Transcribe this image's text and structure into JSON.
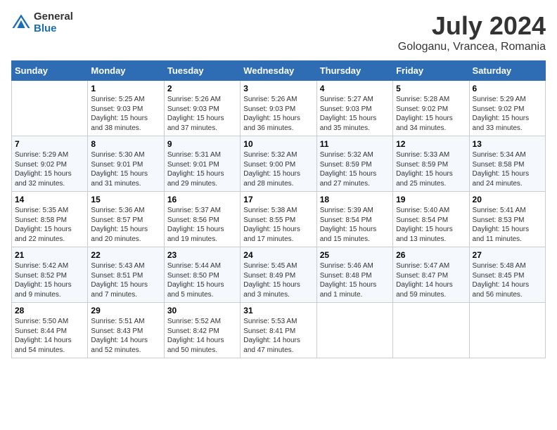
{
  "header": {
    "logo_line1": "General",
    "logo_line2": "Blue",
    "title": "July 2024",
    "subtitle": "Gologanu, Vrancea, Romania"
  },
  "weekdays": [
    "Sunday",
    "Monday",
    "Tuesday",
    "Wednesday",
    "Thursday",
    "Friday",
    "Saturday"
  ],
  "weeks": [
    [
      {
        "day": "",
        "info": ""
      },
      {
        "day": "1",
        "info": "Sunrise: 5:25 AM\nSunset: 9:03 PM\nDaylight: 15 hours\nand 38 minutes."
      },
      {
        "day": "2",
        "info": "Sunrise: 5:26 AM\nSunset: 9:03 PM\nDaylight: 15 hours\nand 37 minutes."
      },
      {
        "day": "3",
        "info": "Sunrise: 5:26 AM\nSunset: 9:03 PM\nDaylight: 15 hours\nand 36 minutes."
      },
      {
        "day": "4",
        "info": "Sunrise: 5:27 AM\nSunset: 9:03 PM\nDaylight: 15 hours\nand 35 minutes."
      },
      {
        "day": "5",
        "info": "Sunrise: 5:28 AM\nSunset: 9:02 PM\nDaylight: 15 hours\nand 34 minutes."
      },
      {
        "day": "6",
        "info": "Sunrise: 5:29 AM\nSunset: 9:02 PM\nDaylight: 15 hours\nand 33 minutes."
      }
    ],
    [
      {
        "day": "7",
        "info": "Sunrise: 5:29 AM\nSunset: 9:02 PM\nDaylight: 15 hours\nand 32 minutes."
      },
      {
        "day": "8",
        "info": "Sunrise: 5:30 AM\nSunset: 9:01 PM\nDaylight: 15 hours\nand 31 minutes."
      },
      {
        "day": "9",
        "info": "Sunrise: 5:31 AM\nSunset: 9:01 PM\nDaylight: 15 hours\nand 29 minutes."
      },
      {
        "day": "10",
        "info": "Sunrise: 5:32 AM\nSunset: 9:00 PM\nDaylight: 15 hours\nand 28 minutes."
      },
      {
        "day": "11",
        "info": "Sunrise: 5:32 AM\nSunset: 8:59 PM\nDaylight: 15 hours\nand 27 minutes."
      },
      {
        "day": "12",
        "info": "Sunrise: 5:33 AM\nSunset: 8:59 PM\nDaylight: 15 hours\nand 25 minutes."
      },
      {
        "day": "13",
        "info": "Sunrise: 5:34 AM\nSunset: 8:58 PM\nDaylight: 15 hours\nand 24 minutes."
      }
    ],
    [
      {
        "day": "14",
        "info": "Sunrise: 5:35 AM\nSunset: 8:58 PM\nDaylight: 15 hours\nand 22 minutes."
      },
      {
        "day": "15",
        "info": "Sunrise: 5:36 AM\nSunset: 8:57 PM\nDaylight: 15 hours\nand 20 minutes."
      },
      {
        "day": "16",
        "info": "Sunrise: 5:37 AM\nSunset: 8:56 PM\nDaylight: 15 hours\nand 19 minutes."
      },
      {
        "day": "17",
        "info": "Sunrise: 5:38 AM\nSunset: 8:55 PM\nDaylight: 15 hours\nand 17 minutes."
      },
      {
        "day": "18",
        "info": "Sunrise: 5:39 AM\nSunset: 8:54 PM\nDaylight: 15 hours\nand 15 minutes."
      },
      {
        "day": "19",
        "info": "Sunrise: 5:40 AM\nSunset: 8:54 PM\nDaylight: 15 hours\nand 13 minutes."
      },
      {
        "day": "20",
        "info": "Sunrise: 5:41 AM\nSunset: 8:53 PM\nDaylight: 15 hours\nand 11 minutes."
      }
    ],
    [
      {
        "day": "21",
        "info": "Sunrise: 5:42 AM\nSunset: 8:52 PM\nDaylight: 15 hours\nand 9 minutes."
      },
      {
        "day": "22",
        "info": "Sunrise: 5:43 AM\nSunset: 8:51 PM\nDaylight: 15 hours\nand 7 minutes."
      },
      {
        "day": "23",
        "info": "Sunrise: 5:44 AM\nSunset: 8:50 PM\nDaylight: 15 hours\nand 5 minutes."
      },
      {
        "day": "24",
        "info": "Sunrise: 5:45 AM\nSunset: 8:49 PM\nDaylight: 15 hours\nand 3 minutes."
      },
      {
        "day": "25",
        "info": "Sunrise: 5:46 AM\nSunset: 8:48 PM\nDaylight: 15 hours\nand 1 minute."
      },
      {
        "day": "26",
        "info": "Sunrise: 5:47 AM\nSunset: 8:47 PM\nDaylight: 14 hours\nand 59 minutes."
      },
      {
        "day": "27",
        "info": "Sunrise: 5:48 AM\nSunset: 8:45 PM\nDaylight: 14 hours\nand 56 minutes."
      }
    ],
    [
      {
        "day": "28",
        "info": "Sunrise: 5:50 AM\nSunset: 8:44 PM\nDaylight: 14 hours\nand 54 minutes."
      },
      {
        "day": "29",
        "info": "Sunrise: 5:51 AM\nSunset: 8:43 PM\nDaylight: 14 hours\nand 52 minutes."
      },
      {
        "day": "30",
        "info": "Sunrise: 5:52 AM\nSunset: 8:42 PM\nDaylight: 14 hours\nand 50 minutes."
      },
      {
        "day": "31",
        "info": "Sunrise: 5:53 AM\nSunset: 8:41 PM\nDaylight: 14 hours\nand 47 minutes."
      },
      {
        "day": "",
        "info": ""
      },
      {
        "day": "",
        "info": ""
      },
      {
        "day": "",
        "info": ""
      }
    ]
  ]
}
